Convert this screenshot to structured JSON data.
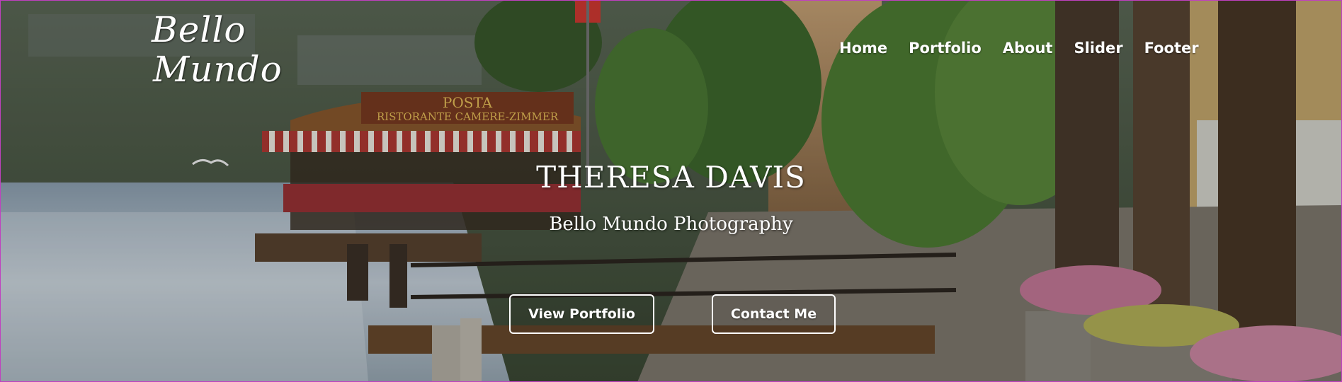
{
  "logo": {
    "line1": "Bello",
    "line2": "Mundo"
  },
  "nav": {
    "items": [
      {
        "label": "Home"
      },
      {
        "label": "Portfolio"
      },
      {
        "label": "About"
      },
      {
        "label": "Slider"
      },
      {
        "label": "Footer"
      }
    ]
  },
  "hero": {
    "title": "THERESA DAVIS",
    "subtitle": "Bello Mundo Photography",
    "buttons": {
      "portfolio": "View Portfolio",
      "contact": "Contact Me"
    }
  },
  "scene": {
    "sign_line1": "POSTA",
    "sign_line2": "RISTORANTE CAMERE-ZIMMER"
  },
  "colors": {
    "text": "#ffffff",
    "awning": "#b23a34",
    "lake": "#aab8c4"
  }
}
